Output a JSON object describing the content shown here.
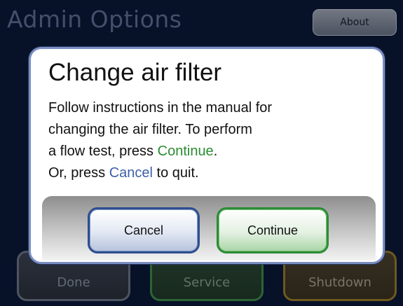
{
  "screen": {
    "title": "Admin Options",
    "about_label": "About",
    "bottom_buttons": [
      {
        "label": "Done"
      },
      {
        "label": "Service"
      },
      {
        "label": "Shutdown"
      }
    ]
  },
  "dialog": {
    "title": "Change air filter",
    "lines": [
      "Follow instructions in the manual for",
      "changing the air filter.  To perform",
      "a flow test, press ",
      "Or, press "
    ],
    "line3_keyword": "Continue",
    "line3_suffix": ".",
    "line4_keyword": "Cancel",
    "line4_suffix": " to quit.",
    "cancel_label": "Cancel",
    "continue_label": "Continue"
  },
  "colors": {
    "background": "#0a1a3a",
    "cancel_accent": "#3d5fa8",
    "continue_accent": "#2a8c32",
    "shutdown_accent": "#9a7a2a"
  }
}
